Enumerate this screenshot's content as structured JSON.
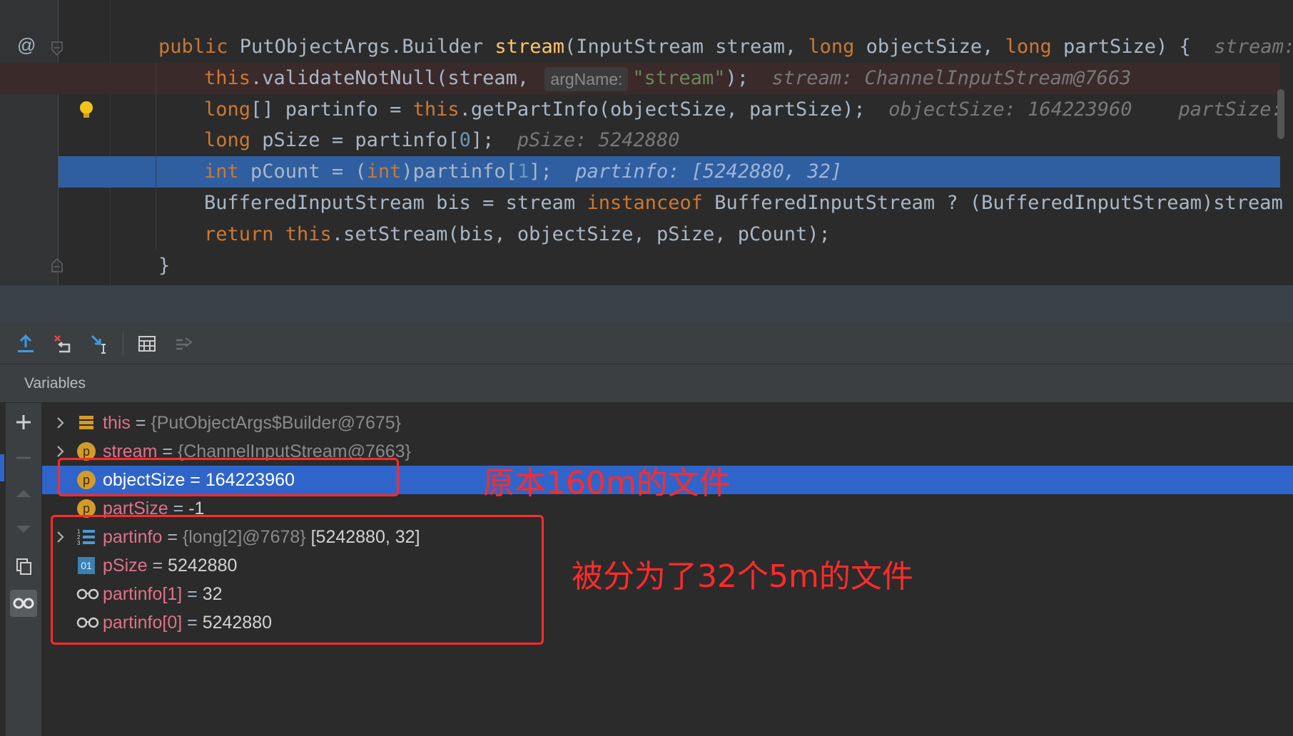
{
  "editor": {
    "gutter_at": "@",
    "lines": [
      {
        "parts": [
          [
            "kw",
            "public "
          ],
          [
            "plain",
            "PutObjectArgs.Builder "
          ],
          [
            "fn",
            "stream"
          ],
          [
            "plain",
            "(InputStream stream, "
          ],
          [
            "kw",
            "long "
          ],
          [
            "plain",
            "objectSize, "
          ],
          [
            "kw",
            "long "
          ],
          [
            "plain",
            "partSize) {  "
          ],
          [
            "hint",
            "stream:"
          ]
        ]
      },
      {
        "parts": [
          [
            "kw",
            "this"
          ],
          [
            "plain",
            ".validateNotNull(stream, "
          ],
          [
            "param",
            "argName:"
          ],
          [
            "str",
            "\"stream\""
          ],
          [
            "plain",
            ");  "
          ],
          [
            "hint",
            "stream: ChannelInputStream@7663"
          ]
        ]
      },
      {
        "parts": [
          [
            "kw",
            "long"
          ],
          [
            "plain",
            "[] partinfo = "
          ],
          [
            "kw",
            "this"
          ],
          [
            "plain",
            ".getPartInfo(objectSize, partSize);  "
          ],
          [
            "hint",
            "objectSize: 164223960    partSize:"
          ]
        ]
      },
      {
        "parts": [
          [
            "kw",
            "long "
          ],
          [
            "plain",
            "pSize = partinfo["
          ],
          [
            "num",
            "0"
          ],
          [
            "plain",
            "];  "
          ],
          [
            "hint",
            "pSize: 5242880"
          ]
        ]
      },
      {
        "parts": [
          [
            "kw",
            "int "
          ],
          [
            "plain",
            "pCount = ("
          ],
          [
            "kw",
            "int"
          ],
          [
            "plain",
            ")partinfo["
          ],
          [
            "num",
            "1"
          ],
          [
            "plain",
            "];  "
          ],
          [
            "hintsel",
            "partinfo: [5242880, 32]"
          ]
        ]
      },
      {
        "parts": [
          [
            "plain",
            "BufferedInputStream bis = stream "
          ],
          [
            "kw",
            "instanceof "
          ],
          [
            "plain",
            "BufferedInputStream ? (BufferedInputStream)stream"
          ]
        ]
      },
      {
        "parts": [
          [
            "kw",
            "return this"
          ],
          [
            "plain",
            ".setStream(bis, objectSize, pSize, pCount);"
          ]
        ]
      },
      {
        "parts": [
          [
            "plain",
            "}"
          ]
        ]
      }
    ]
  },
  "variables_panel": {
    "title": "Variables",
    "rows": [
      {
        "name": "this",
        "eq": " = ",
        "type": "{PutObjectArgs$Builder@7675}",
        "value": "",
        "icon": "field-list-icon",
        "expandable": true
      },
      {
        "name": "stream",
        "eq": " = ",
        "type": "{ChannelInputStream@7663}",
        "value": "",
        "icon": "parameter-icon",
        "expandable": true
      },
      {
        "name": "objectSize",
        "eq": " = ",
        "type": "",
        "value": "164223960",
        "icon": "parameter-icon",
        "expandable": false
      },
      {
        "name": "partSize",
        "eq": " = ",
        "type": "",
        "value": "-1",
        "icon": "parameter-icon",
        "expandable": false
      },
      {
        "name": "partinfo",
        "eq": " = ",
        "type": "{long[2]@7678} ",
        "value": "[5242880, 32]",
        "icon": "array-icon",
        "expandable": true
      },
      {
        "name": "pSize",
        "eq": " = ",
        "type": "",
        "value": "5242880",
        "icon": "primitive-icon",
        "expandable": false
      },
      {
        "name": "partinfo[1]",
        "eq": " = ",
        "type": "",
        "value": "32",
        "icon": "watch-icon",
        "expandable": false
      },
      {
        "name": "partinfo[0]",
        "eq": " = ",
        "type": "",
        "value": "5242880",
        "icon": "watch-icon",
        "expandable": false
      }
    ]
  },
  "annotations": {
    "note_1": "原本160m的文件",
    "note_2": "被分为了32个5m的文件"
  },
  "icons": {
    "p_letter": "p",
    "primitive_letter": "01"
  },
  "colors": {
    "selection": "#2f65ca",
    "annotation": "#ff2b2b",
    "keyword": "#cc7832"
  }
}
